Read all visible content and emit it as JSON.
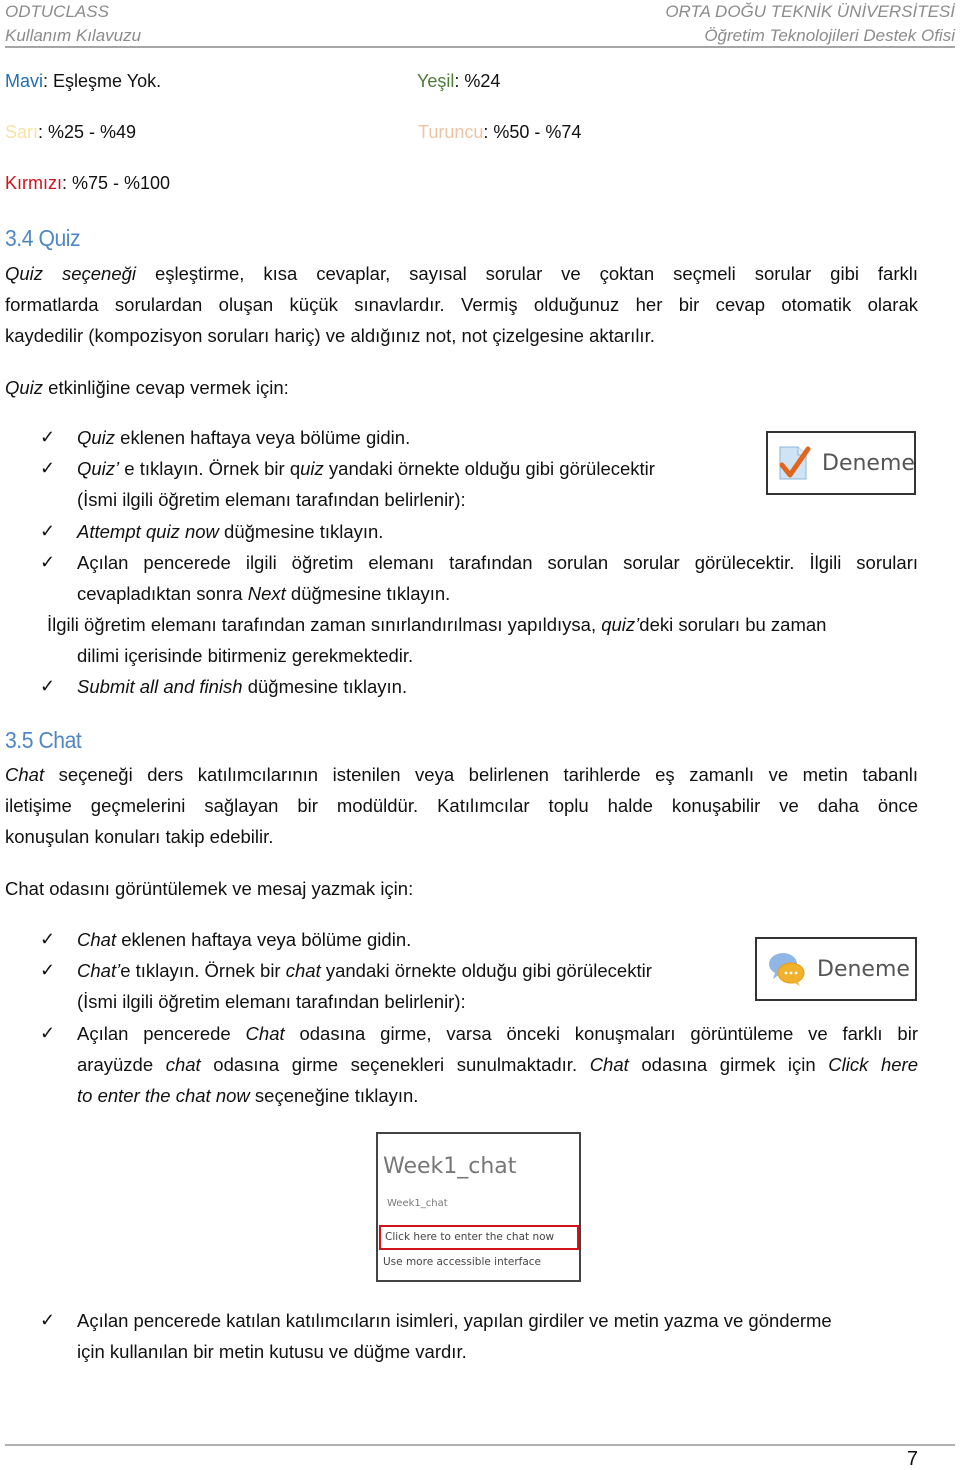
{
  "header": {
    "left_line1": "ODTUCLASS",
    "left_line2": "Kullanım Kılavuzu",
    "right_line1": "ORTA DOĞU TEKNİK ÜNİVERSİTESİ",
    "right_line2": "Öğretim Teknolojileri Destek Ofisi"
  },
  "legend": [
    {
      "color_name": "Mavi",
      "value": ": Eşleşme Yok.",
      "color": "#1f6fb0"
    },
    {
      "color_name": "Yeşil",
      "value": ": %24",
      "color": "#4f7b3a"
    },
    {
      "color_name": "Sarı",
      "value": ": %25 - %49",
      "color": "#f6e3a6"
    },
    {
      "color_name": "Turuncu",
      "value": ": %50 - %74",
      "color": "#f0c3a4"
    },
    {
      "color_name": "Kırmızı",
      "value": ": %75 - %100",
      "color": "#d0141b"
    }
  ],
  "quiz": {
    "heading": "3.4 Quiz",
    "intro_em": "Quiz seçeneği",
    "intro_line1": " eşleştirme, kısa cevaplar, sayısal sorular ve çoktan seçmeli sorular gibi farklı",
    "intro_line2": "formatlarda sorulardan oluşan küçük sınavlardır. Vermiş olduğunuz her bir cevap otomatik olarak",
    "intro_line3": "kaydedilir (kompozisyon soruları hariç) ve aldığınız not, not çizelgesine aktarılır.",
    "lead_em": "Quiz",
    "lead_rest": " etkinliğine cevap vermek için:",
    "steps": {
      "s1_em": "Quiz",
      "s1_rest": " eklenen haftaya veya bölüme gidin.",
      "s2_em1": "Quiz’",
      "s2_mid1": " e tıklayın. Örnek bir q",
      "s2_em2": "uiz",
      "s2_rest": " yandaki örnekte olduğu gibi görülecektir",
      "s2_line2": "(İsmi ilgili öğretim elemanı tarafından belirlenir):",
      "s3_em": "Attempt quiz now",
      "s3_rest": " düğmesine tıklayın.",
      "s4_line1": "Açılan pencerede ilgili öğretim elemanı tarafından sorulan sorular görülecektir. İlgili soruları",
      "s4_line2_pre": "cevapladıktan sonra ",
      "s4_line2_em": "Next",
      "s4_line2_rest": " düğmesine tıklayın.",
      "note_pre": "İlgili öğretim elemanı tarafından zaman sınırlandırılması yapıldıysa, ",
      "note_em": "quiz’",
      "note_rest": "deki soruları bu zaman",
      "note_line2": "dilimi içerisinde bitirmeniz gerekmektedir.",
      "s5_em": "Submit all and finish",
      "s5_rest": " düğmesine tıklayın."
    },
    "example_label": "Deneme"
  },
  "chat": {
    "heading": "3.5 Chat",
    "intro_em": "Chat",
    "intro_line1": " seçeneği ders katılımcılarının istenilen veya belirlenen tarihlerde eş zamanlı ve metin tabanlı",
    "intro_line2": "iletişime geçmelerini sağlayan bir modüldür. Katılımcılar toplu halde konuşabilir ve daha önce",
    "intro_line3": "konuşulan konuları takip edebilir.",
    "lead": "Chat odasını görüntülemek ve mesaj yazmak için:",
    "steps": {
      "s1_em": "Chat",
      "s1_rest": " eklenen haftaya veya bölüme gidin.",
      "s2_em1": "Chat’",
      "s2_mid1": "e tıklayın. Örnek bir ",
      "s2_em2": "chat",
      "s2_rest": " yandaki örnekte olduğu gibi görülecektir",
      "s2_line2": "(İsmi ilgili öğretim elemanı tarafından belirlenir):",
      "s3_pre": "Açılan pencerede ",
      "s3_em": "Chat",
      "s3_rest": " odasına girme, varsa önceki konuşmaları görüntüleme ve farklı bir",
      "s3_l2_pre": "arayüzde ",
      "s3_l2_em1": "chat",
      "s3_l2_mid": " odasına girme seçenekleri sunulmaktadır. ",
      "s3_l2_em2": "Chat",
      "s3_l2_mid2": " odasına girmek için ",
      "s3_l2_em3": "Click here",
      "s3_l3_em": "to enter the chat now",
      "s3_l3_rest": " seçeneğine tıklayın.",
      "s4_line1": "Açılan pencerede katılan katılımcıların isimleri, yapılan girdiler ve metin yazma ve gönderme",
      "s4_line2": "için kullanılan bir metin kutusu ve düğme vardır."
    },
    "example_label": "Deneme",
    "screenshot": {
      "title": "Week1_chat",
      "subtitle": "Week1_chat",
      "link_enter": "Click here to enter the chat now",
      "link_accessible": "Use more accessible interface"
    }
  },
  "check_glyph": "✓",
  "page_number": "7"
}
